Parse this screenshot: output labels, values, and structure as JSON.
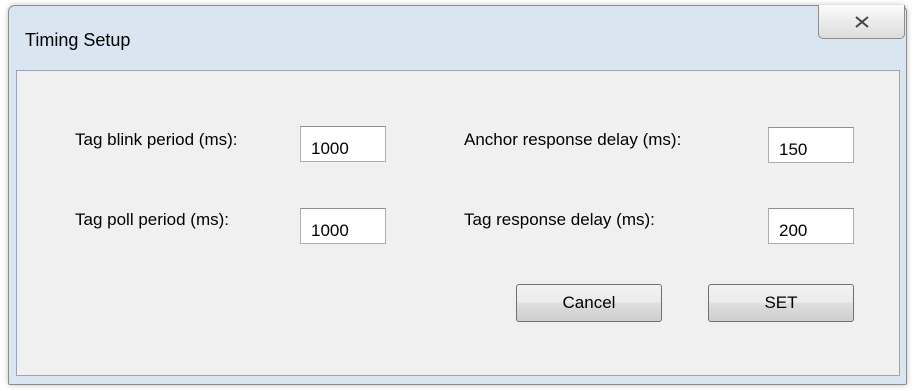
{
  "window": {
    "title": "Timing Setup",
    "close_icon": "close-icon"
  },
  "fields": {
    "tag_blink_period": {
      "label": "Tag blink period (ms):",
      "value": "1000"
    },
    "tag_poll_period": {
      "label": "Tag poll period (ms):",
      "value": "1000"
    },
    "anchor_response_delay": {
      "label": "Anchor response delay (ms):",
      "value": "150"
    },
    "tag_response_delay": {
      "label": "Tag response delay (ms):",
      "value": "200"
    }
  },
  "buttons": {
    "cancel_label": "Cancel",
    "set_label": "SET"
  }
}
